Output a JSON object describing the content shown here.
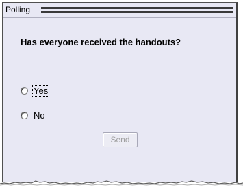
{
  "panel": {
    "title": "Polling"
  },
  "poll": {
    "question": "Has everyone received the handouts?",
    "options": [
      {
        "label": "Yes",
        "selected": false,
        "focused": true
      },
      {
        "label": "No",
        "selected": false,
        "focused": false
      }
    ],
    "send_label": "Send",
    "send_enabled": false
  },
  "colors": {
    "panel_bg": "#e8e8f4",
    "frame": "#404040",
    "disabled_text": "#a0a0a0"
  }
}
